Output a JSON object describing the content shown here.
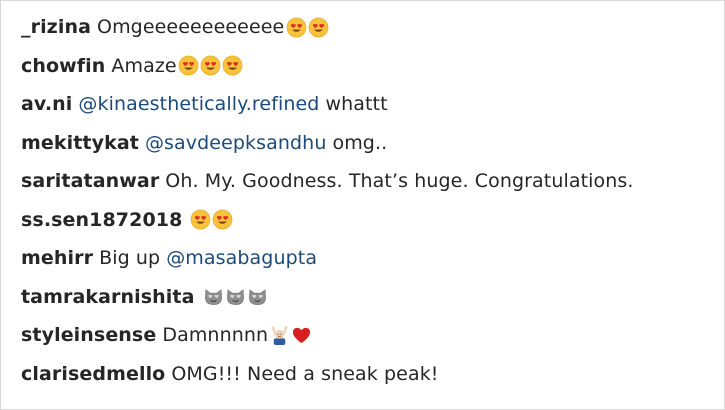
{
  "comments": [
    {
      "user": "_rizina",
      "text": "Omgeeeeeeeeeeee",
      "emojis": [
        "heart-eyes-icon",
        "heart-eyes-icon"
      ]
    },
    {
      "user": "chowfin",
      "text": "Amaze",
      "emojis": [
        "heart-eyes-icon",
        "heart-eyes-icon",
        "heart-eyes-icon"
      ]
    },
    {
      "user": "av.ni",
      "mention": "@kinaesthetically.refined",
      "text": "whattt"
    },
    {
      "user": "mekittykat",
      "mention": "@savdeepksandhu",
      "text": "omg.."
    },
    {
      "user": "saritatanwar",
      "text": "Oh. My. Goodness. That’s huge. Congratulations."
    },
    {
      "user": "ss.sen1872018",
      "emojis": [
        "heart-eyes-icon",
        "heart-eyes-icon"
      ]
    },
    {
      "user": "mehirr",
      "text": "Big up",
      "mention": "@masabagupta"
    },
    {
      "user": "tamrakarnishita",
      "emojis": [
        "heart-eyes-cat-icon",
        "heart-eyes-cat-icon",
        "heart-eyes-cat-icon"
      ]
    },
    {
      "user": "styleinsense",
      "text": "Damnnnnn",
      "emojis": [
        "raising-hands-person-icon",
        "red-heart-icon"
      ]
    },
    {
      "user": "clarisedmello",
      "text": "OMG!!! Need a sneak peak!"
    }
  ]
}
